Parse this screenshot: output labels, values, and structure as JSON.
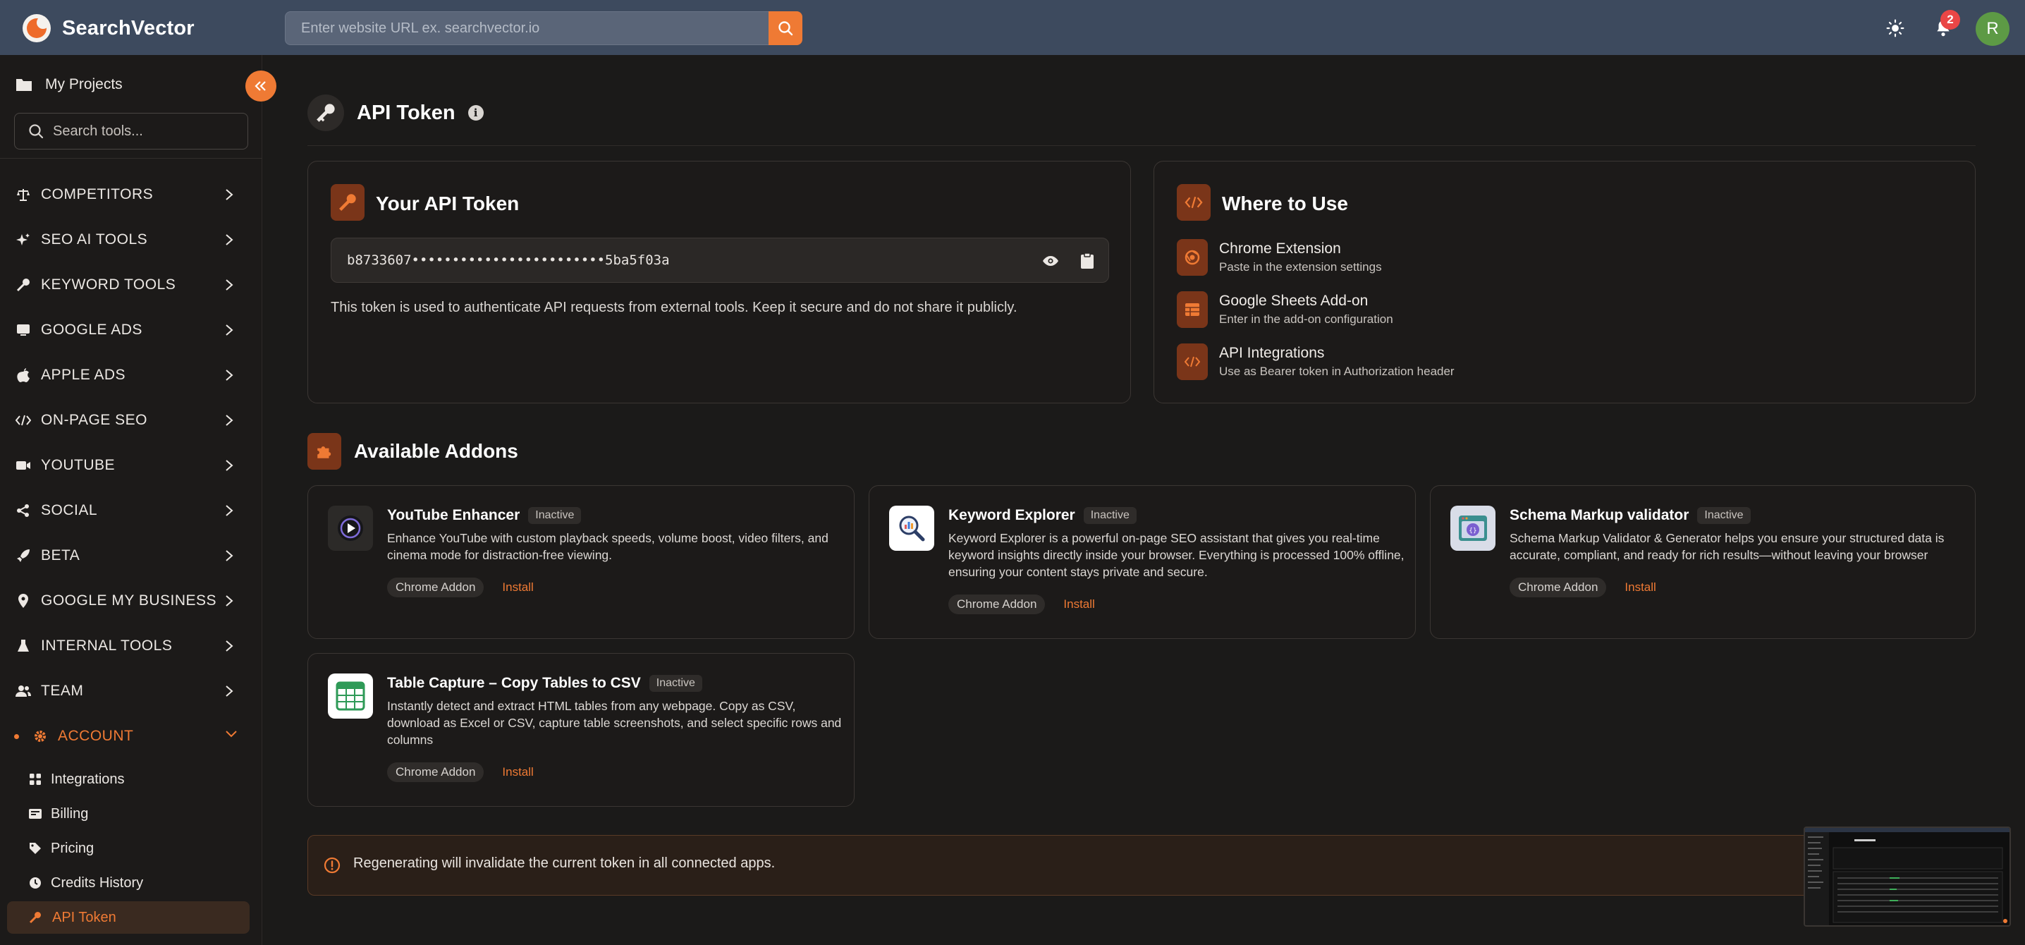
{
  "app": {
    "brand": "SearchVector",
    "url_placeholder": "Enter website URL ex. searchvector.io",
    "notifications_count": "2",
    "user_initial": "R"
  },
  "sidebar": {
    "projects_label": "My Projects",
    "tool_search_placeholder": "Search tools...",
    "groups": [
      {
        "label": "COMPETITORS",
        "icon": "scale-icon"
      },
      {
        "label": "SEO AI TOOLS",
        "icon": "sparkles-icon"
      },
      {
        "label": "KEYWORD TOOLS",
        "icon": "key-icon"
      },
      {
        "label": "GOOGLE ADS",
        "icon": "ad-icon"
      },
      {
        "label": "APPLE ADS",
        "icon": "apple-icon"
      },
      {
        "label": "ON-PAGE SEO",
        "icon": "code-icon"
      },
      {
        "label": "YOUTUBE",
        "icon": "video-icon"
      },
      {
        "label": "SOCIAL",
        "icon": "share-icon"
      },
      {
        "label": "BETA",
        "icon": "rocket-icon"
      },
      {
        "label": "GOOGLE MY BUSINESS",
        "icon": "map-pin-icon"
      },
      {
        "label": "INTERNAL TOOLS",
        "icon": "flask-icon"
      },
      {
        "label": "TEAM",
        "icon": "users-icon"
      }
    ],
    "account": {
      "label": "ACCOUNT",
      "items": [
        {
          "label": "Integrations",
          "icon": "grid-icon"
        },
        {
          "label": "Billing",
          "icon": "receipt-icon"
        },
        {
          "label": "Pricing",
          "icon": "tag-icon"
        },
        {
          "label": "Credits History",
          "icon": "clock-icon"
        },
        {
          "label": "API Token",
          "icon": "key-icon"
        }
      ]
    }
  },
  "page": {
    "title": "API Token",
    "token_card": {
      "title": "Your API Token",
      "token": "b8733607••••••••••••••••••••••••5ba5f03a",
      "note": "This token is used to authenticate API requests from external tools. Keep it secure and do not share it publicly."
    },
    "where_card": {
      "title": "Where to Use",
      "items": [
        {
          "title": "Chrome Extension",
          "subtitle": "Paste in the extension settings"
        },
        {
          "title": "Google Sheets Add-on",
          "subtitle": "Enter in the add-on configuration"
        },
        {
          "title": "API Integrations",
          "subtitle": "Use as Bearer token in Authorization header"
        }
      ]
    },
    "addons_title": "Available Addons",
    "addons": [
      {
        "name": "YouTube Enhancer",
        "status": "Inactive",
        "description_lines": [
          "Enhance YouTube with custom playback speeds, volume boost, video filters, and",
          "cinema mode for distraction-free viewing."
        ],
        "type": "Chrome Addon",
        "action": "Install"
      },
      {
        "name": "Keyword Explorer",
        "status": "Inactive",
        "description_lines": [
          "Keyword Explorer is a powerful on-page SEO assistant that gives you real-time",
          "keyword insights directly inside your browser. Everything is processed 100% offline,",
          "ensuring your content stays private and secure."
        ],
        "type": "Chrome Addon",
        "action": "Install"
      },
      {
        "name": "Schema Markup validator",
        "status": "Inactive",
        "description_lines": [
          "Schema Markup Validator & Generator helps you ensure your structured data is",
          "accurate, compliant, and ready for rich results—without leaving your browser"
        ],
        "type": "Chrome Addon",
        "action": "Install"
      },
      {
        "name": "Table Capture – Copy Tables to CSV",
        "status": "Inactive",
        "description_lines": [
          "Instantly detect and extract HTML tables from any webpage. Copy as CSV,",
          "download as Excel or CSV, capture table screenshots, and select specific rows and",
          "columns"
        ],
        "type": "Chrome Addon",
        "action": "Install"
      }
    ],
    "warning": "Regenerating will invalidate the current token in all connected apps."
  },
  "colors": {
    "accent": "#ef7a34",
    "topbar": "#3d4a5e",
    "background": "#1b1a19",
    "icon_tile": "#7a3519"
  }
}
